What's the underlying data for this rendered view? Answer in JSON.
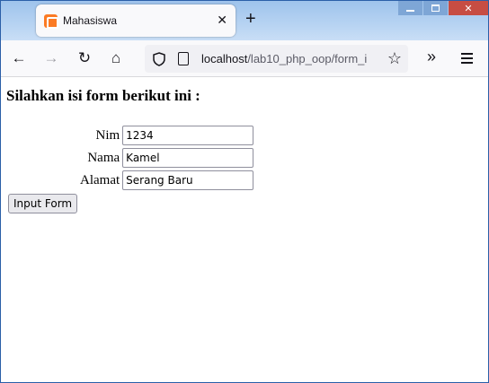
{
  "browser": {
    "tab": {
      "title": "Mahasiswa",
      "favicon": "xampp-icon",
      "close_glyph": "✕"
    },
    "new_tab_glyph": "+",
    "window_controls": {
      "close_glyph": "✕"
    },
    "urlbar": {
      "host": "localhost",
      "path": "/lab10_php_oop/form_i"
    },
    "icons": {
      "back": "←",
      "forward": "→",
      "reload": "↻",
      "home": "⌂",
      "star": "☆",
      "overflow": "»"
    }
  },
  "page": {
    "heading": "Silahkan isi form berikut ini :",
    "fields": [
      {
        "label": "Nim",
        "value": "1234"
      },
      {
        "label": "Nama",
        "value": "Kamel"
      },
      {
        "label": "Alamat",
        "value": "Serang Baru"
      }
    ],
    "submit_label": "Input Form"
  },
  "colors": {
    "titlebar": "#b7d3f2",
    "accent_favicon": "#fb7a24",
    "close_button": "#c74d43"
  }
}
